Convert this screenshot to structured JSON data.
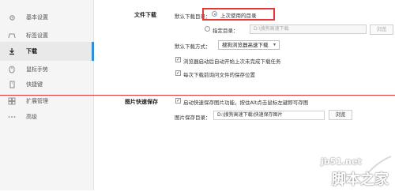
{
  "sidebar": {
    "items": [
      {
        "label": "基本设置",
        "icon": "gear-icon"
      },
      {
        "label": "标签设置",
        "icon": "tab-icon"
      },
      {
        "label": "下载",
        "icon": "download-icon",
        "active": true
      },
      {
        "label": "鼠标手势",
        "icon": "mouse-gesture-icon"
      },
      {
        "label": "快捷键",
        "icon": "keyboard-shortcut-icon"
      },
      {
        "label": "扩展管理",
        "icon": "extension-icon"
      },
      {
        "label": "高级",
        "icon": "more-icon"
      }
    ]
  },
  "download": {
    "section_title": "文件下载",
    "default_dir_label": "默认下载目录：",
    "option_last_used": "上次使用的目录",
    "option_specified": "指定目录：",
    "specified_path": "D:\\搜狗高速下载",
    "browse_button": "浏览",
    "default_method_label": "默认下载方式：",
    "default_method_value": "搜狗浏览器高速下载",
    "auto_resume": "浏览器启动后自动开始上次未完成下载任务",
    "ask_location": "每次下载前询问文件的保存位置"
  },
  "image_save": {
    "section_title": "图片快速保存",
    "enable_text": "启动快速保存图片功能，按住Alt点击鼠标左键即可存图",
    "dir_label": "图片保存目录：",
    "dir_value": "D:\\搜狗高速下载\\快速保存图片",
    "browse_button": "浏览"
  },
  "watermark": {
    "url": "jb51.net",
    "name": "脚本之家"
  },
  "colors": {
    "highlight": "#e53838",
    "accent": "#2f8fd8"
  }
}
